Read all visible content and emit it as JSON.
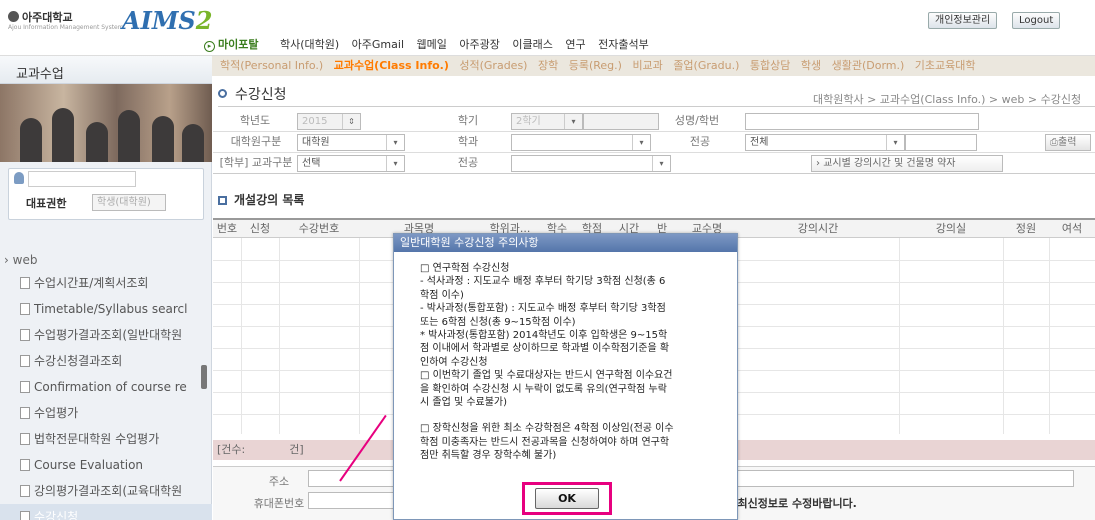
{
  "header": {
    "univ_name": "아주대학교",
    "univ_sub": "Ajou Information Management System",
    "app_name": "AIMS",
    "app_version": "2",
    "top_buttons": [
      "개인정보관리",
      "Logout"
    ],
    "nav1": [
      "마이포탈",
      "학사(대학원)",
      "아주Gmail",
      "웹메일",
      "아주광장",
      "이클래스",
      "연구",
      "전자출석부"
    ],
    "nav2": [
      "학적(Personal Info.)",
      "교과수업(Class Info.)",
      "성적(Grades)",
      "장학",
      "등록(Reg.)",
      "비교과",
      "졸업(Gradu.)",
      "통합상담",
      "학생",
      "생활관(Dorm.)",
      "기초교육대학"
    ]
  },
  "sidebar": {
    "title": "교과수업",
    "role_label": "대표권한",
    "role_select": "학생(대학원)",
    "root": "web",
    "items": [
      "수업시간표/계획서조회",
      "Timetable/Syllabus searcl",
      "수업평가결과조회(일반대학원",
      "수강신청결과조회",
      "Confirmation of course re",
      "수업평가",
      "법학전문대학원 수업평가",
      "Course Evaluation",
      "강의평가결과조회(교육대학원",
      "수강신청"
    ]
  },
  "page": {
    "title": "수강신청",
    "breadcrumb": "대학원학사 > 교과수업(Class Info.) > web > 수강신청",
    "form": {
      "year_label": "학년도",
      "year_value": "2015",
      "term_label": "학기",
      "term_value": "2학기",
      "name_label": "성명/학번",
      "div_label": "대학원구분",
      "div_value": "대학원",
      "dept_label": "학과",
      "major_label": "전공",
      "major_value": "전체",
      "print_button": "출력",
      "undergrad_label": "[학부] 교과구분",
      "undergrad_value": "선택",
      "major2_label": "전공",
      "timetable_button": "교시별 강의시간 및 건물명 약자"
    },
    "section_title": "개설강의 목록",
    "columns": [
      "번호",
      "신청",
      "수강번호",
      "과목명",
      "학위과...",
      "학수",
      "학점",
      "시간",
      "반",
      "교수명",
      "강의시간",
      "강의실",
      "정원",
      "여석"
    ],
    "count_label": "[건수:",
    "count_suffix": "건]",
    "address_label": "주소",
    "phone_label": "휴대폰번호",
    "notice_text": "* 주소 및 연락처 정보는 (조회 > 신상) 메뉴에서 최신정보로 수정바랍니다."
  },
  "modal": {
    "title": "일반대학원 수강신청 주의사항",
    "lines": [
      "□ 연구학점 수강신청",
      " - 석사과정 : 지도교수 배정 후부터 학기당 3학점 신청(총 6",
      "학점 이수)",
      " - 박사과정(통합포함) : 지도교수 배정 후부터 학기당 3학점",
      "또는 6학점 신청(총 9~15학점 이수)",
      "  * 박사과정(통합포함) 2014학년도 이후 입학생은 9~15학",
      "점 이내에서 학과별로 상이하므로 학과별 이수학점기준을 확",
      "인하여 수강신청",
      "□ 이번학기 졸업 및 수료대상자는 반드시 연구학점 이수요건",
      "을 확인하여 수강신청 시 누락이 없도록 유의(연구학점 누락",
      "시 졸업 및 수료불가)",
      "",
      "□ 장학신청을 위한 최소 수강학점은 4학점 이상임(전공 이수",
      "학점 미충족자는 반드시 전공과목을 신청하여야 하며 연구학",
      "점만 취득할 경우 장학수혜 불가)"
    ],
    "ok_button": "OK"
  }
}
